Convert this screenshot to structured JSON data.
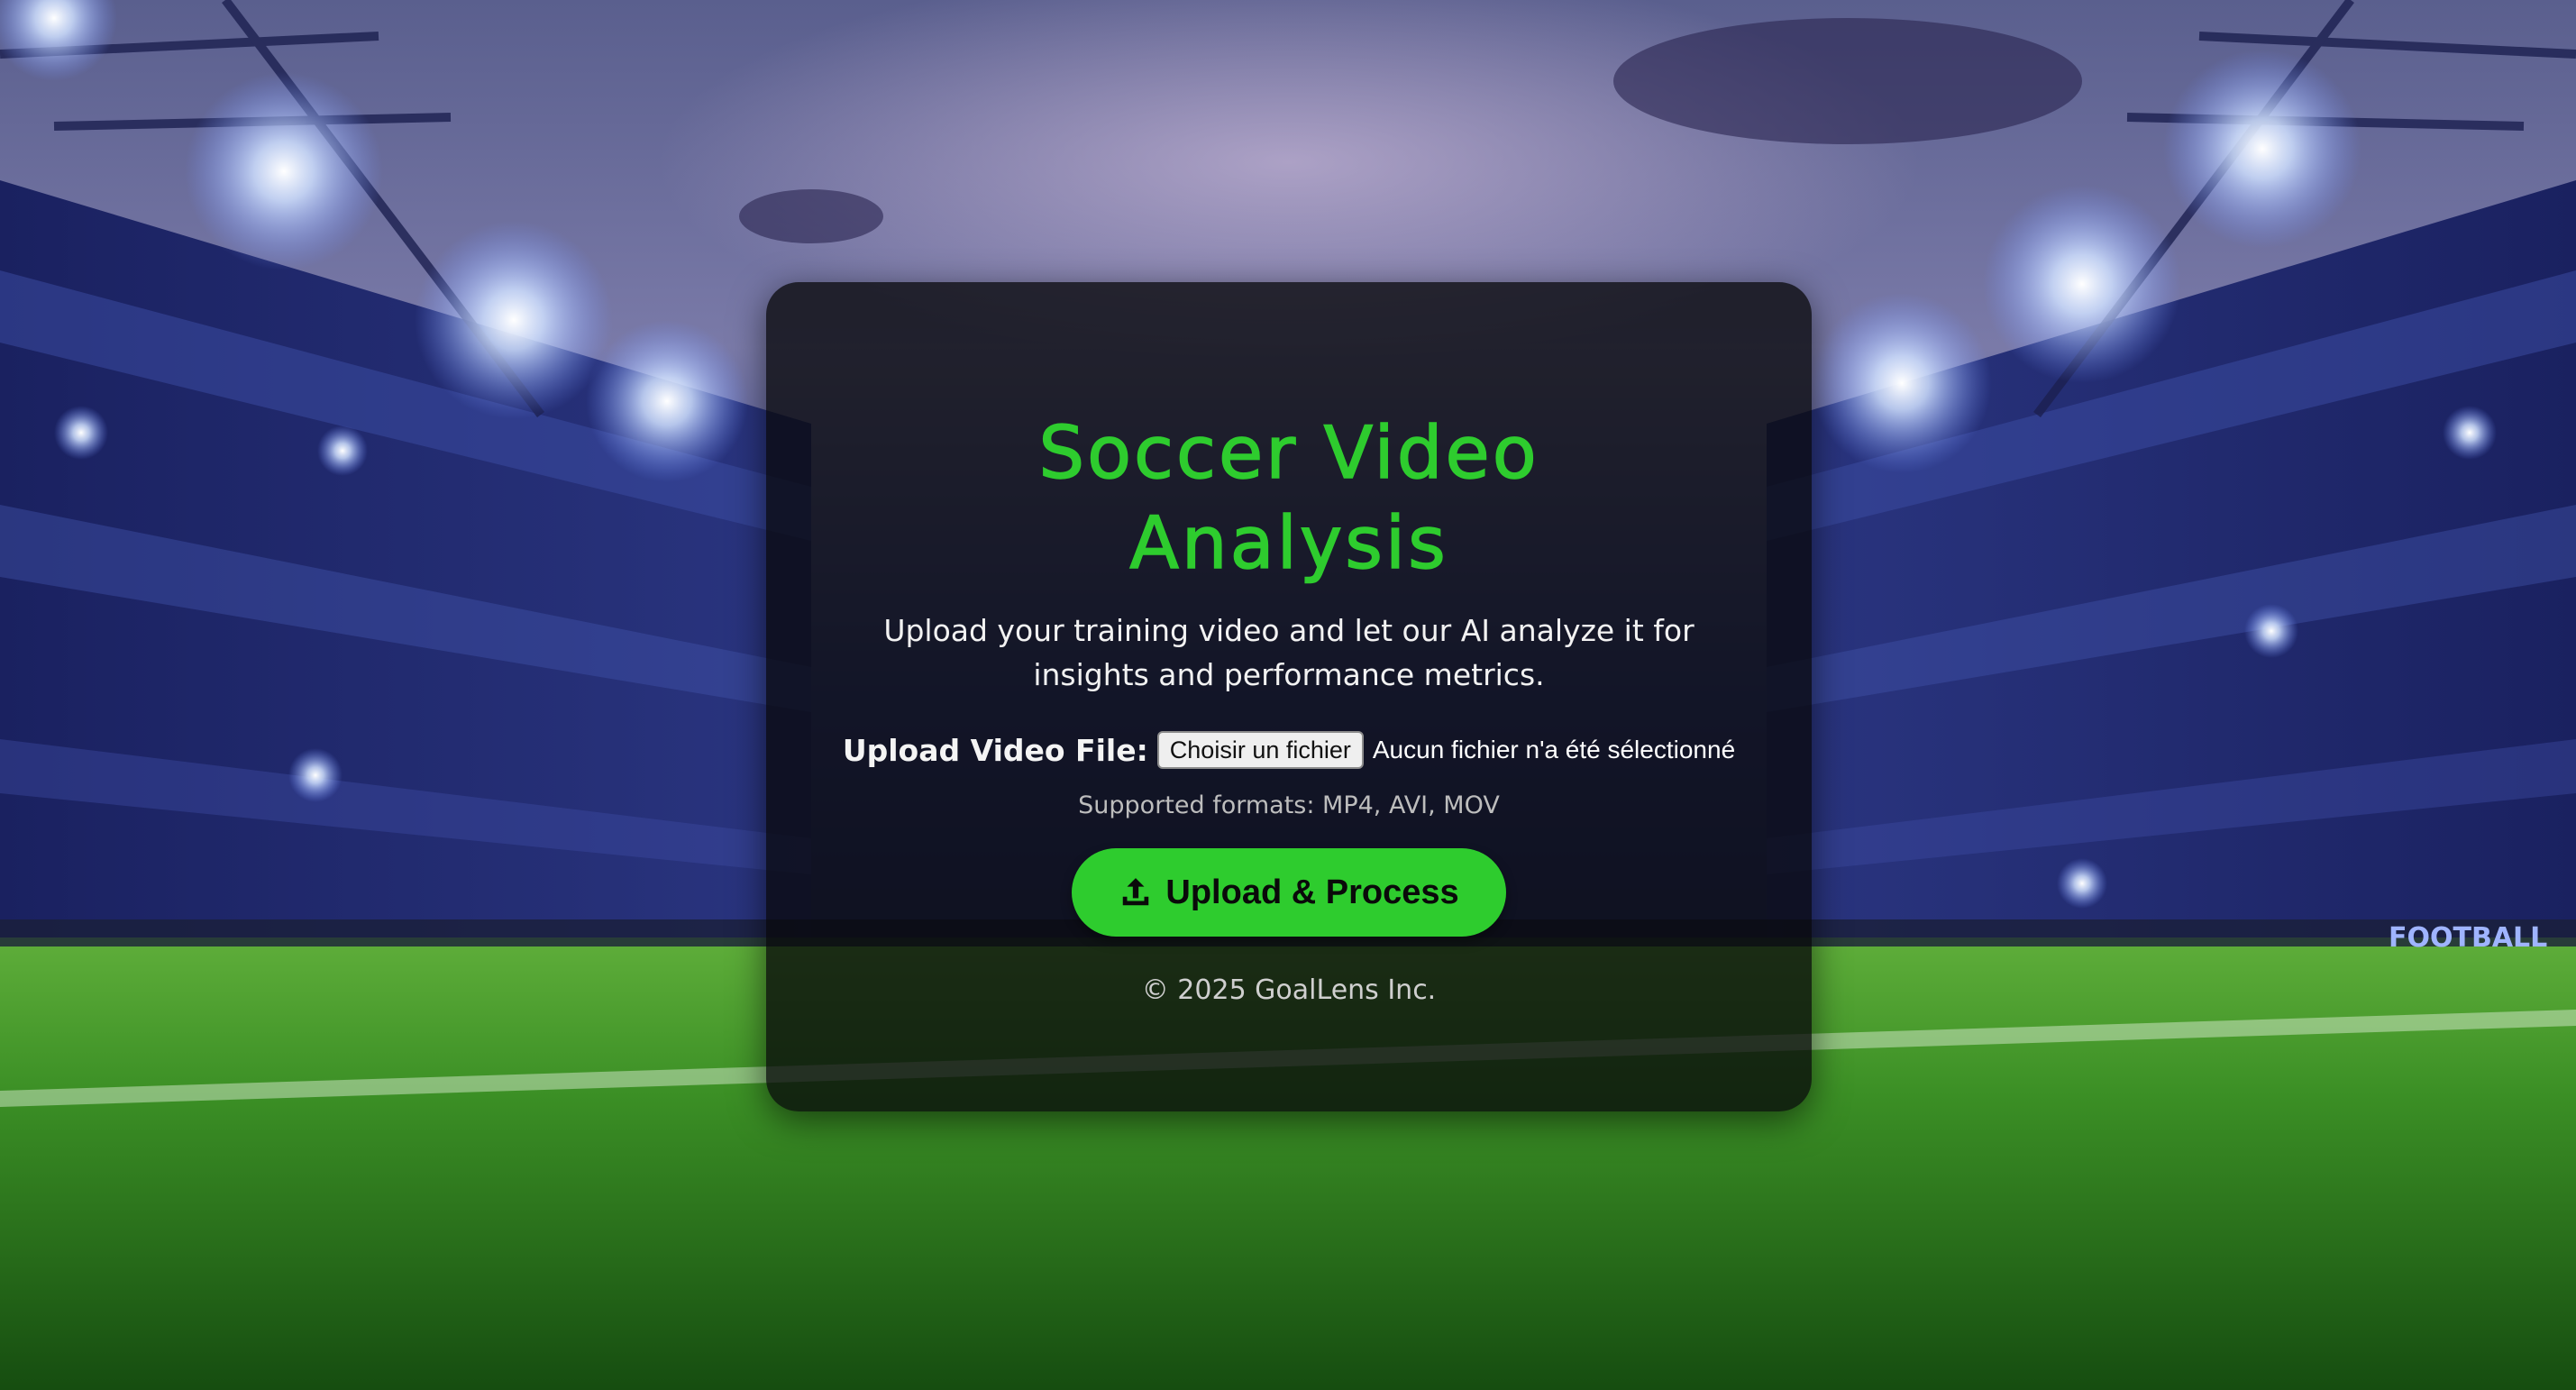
{
  "card": {
    "title": "Soccer Video Analysis",
    "subtitle": "Upload your training video and let our AI analyze it for insights and performance metrics.",
    "upload_label": "Upload Video File:",
    "file_button_label": "Choisir un fichier",
    "file_status": "Aucun fichier n'a été sélectionné",
    "supported_formats": "Supported formats: MP4, AVI, MOV",
    "process_button_label": "Upload & Process",
    "process_button_icon": "upload-icon",
    "footer": "© 2025 GoalLens Inc."
  },
  "background": {
    "stadium_banner_text": "FOOTBALL"
  },
  "colors": {
    "accent": "#2ecc2e",
    "card_background": "#0a0a0c",
    "text": "#ffffff",
    "muted": "#bdbdbd"
  }
}
